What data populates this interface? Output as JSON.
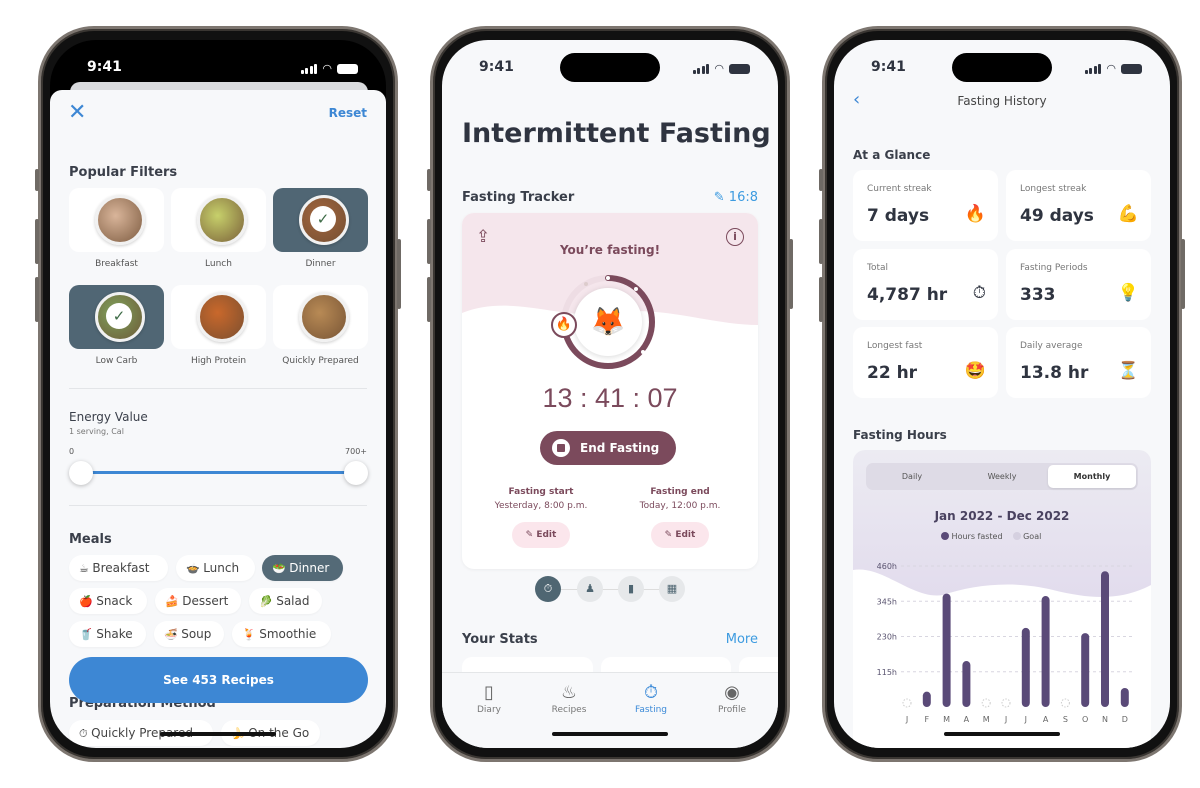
{
  "colors": {
    "accent": "#3d87d4",
    "fasting": "#7b4a5c",
    "chart_bar": "#5a4a78",
    "selected": "#546a77"
  },
  "status_time": "9:41",
  "filters": {
    "close_icon": "close-icon",
    "reset": "Reset",
    "popular_title": "Popular Filters",
    "tiles": [
      {
        "label": "Breakfast",
        "selected": false,
        "food": "#d9b59a"
      },
      {
        "label": "Lunch",
        "selected": false,
        "food": "#c7d06b"
      },
      {
        "label": "Dinner",
        "selected": true,
        "food": "#a2663f"
      },
      {
        "label": "Low Carb",
        "selected": true,
        "food": "#7fa35d"
      },
      {
        "label": "High Protein",
        "selected": false,
        "food": "#c9682c"
      },
      {
        "label": "Quickly Prepared",
        "selected": false,
        "food": "#b88a55"
      }
    ],
    "energy": {
      "title": "Energy Value",
      "subtitle": "1 serving, Cal",
      "min": "0",
      "max": "700+",
      "range": [
        0,
        700
      ]
    },
    "meals_title": "Meals",
    "meals": [
      {
        "emoji": "☕",
        "label": "Breakfast",
        "selected": false
      },
      {
        "emoji": "🍲",
        "label": "Lunch",
        "selected": false
      },
      {
        "emoji": "🥗",
        "label": "Dinner",
        "selected": true
      },
      {
        "emoji": "🍎",
        "label": "Snack",
        "selected": false
      },
      {
        "emoji": "🍰",
        "label": "Dessert",
        "selected": false
      },
      {
        "emoji": "🥬",
        "label": "Salad",
        "selected": false
      },
      {
        "emoji": "🥤",
        "label": "Shake",
        "selected": false
      },
      {
        "emoji": "🍜",
        "label": "Soup",
        "selected": false
      },
      {
        "emoji": "🍹",
        "label": "Smoothie",
        "selected": false
      }
    ],
    "see_button": "See 453 Recipes",
    "prep_title": "Preparation Method",
    "prep": [
      {
        "emoji": "⏱",
        "label": "Quickly Prepared"
      },
      {
        "emoji": "🍌",
        "label": "On the Go"
      }
    ]
  },
  "fasting": {
    "title": "Intermittent Fasting",
    "tracker_title": "Fasting Tracker",
    "plan": "16:8",
    "status": "You’re fasting!",
    "avatar": "🦊",
    "badge": "🔥",
    "progress": 0.7,
    "timer": "13 : 41 : 07",
    "end_button": "End Fasting",
    "start_label": "Fasting start",
    "start_value": "Yesterday, 8:00 p.m.",
    "end_label": "Fasting end",
    "end_value": "Today, 12:00 p.m.",
    "edit": "Edit",
    "stats_title": "Your Stats",
    "more": "More",
    "tabs": [
      {
        "label": "Diary",
        "icon": "book-icon"
      },
      {
        "label": "Recipes",
        "icon": "chef-hat-icon"
      },
      {
        "label": "Fasting",
        "icon": "stopwatch-icon",
        "active": true
      },
      {
        "label": "Profile",
        "icon": "profile-icon"
      }
    ]
  },
  "history": {
    "title": "Fasting History",
    "glance_title": "At a Glance",
    "cards": [
      {
        "label": "Current streak",
        "value": "7 days",
        "emoji": "🔥"
      },
      {
        "label": "Longest streak",
        "value": "49 days",
        "emoji": "💪"
      },
      {
        "label": "Total",
        "value": "4,787 hr",
        "emoji": "⏱"
      },
      {
        "label": "Fasting Periods",
        "value": "333",
        "emoji": "💡"
      },
      {
        "label": "Longest fast",
        "value": "22 hr",
        "emoji": "🤩"
      },
      {
        "label": "Daily average",
        "value": "13.8 hr",
        "emoji": "⏳"
      }
    ],
    "hours_title": "Fasting Hours",
    "segments": [
      "Daily",
      "Weekly",
      "Monthly"
    ],
    "active_segment": "Monthly"
  },
  "chart_data": {
    "type": "bar",
    "title": "Jan 2022 - Dec 2022",
    "legend": [
      "Hours fasted",
      "Goal"
    ],
    "categories": [
      "J",
      "F",
      "M",
      "A",
      "M",
      "J",
      "J",
      "A",
      "S",
      "O",
      "N",
      "D"
    ],
    "series": [
      {
        "name": "Hours fasted",
        "values": [
          0,
          50,
          370,
          150,
          0,
          0,
          258,
          362,
          0,
          241,
          443,
          62
        ]
      }
    ],
    "yticks": [
      "115h",
      "230h",
      "345h",
      "460h"
    ],
    "ylim": [
      0,
      460
    ],
    "grid": true
  }
}
